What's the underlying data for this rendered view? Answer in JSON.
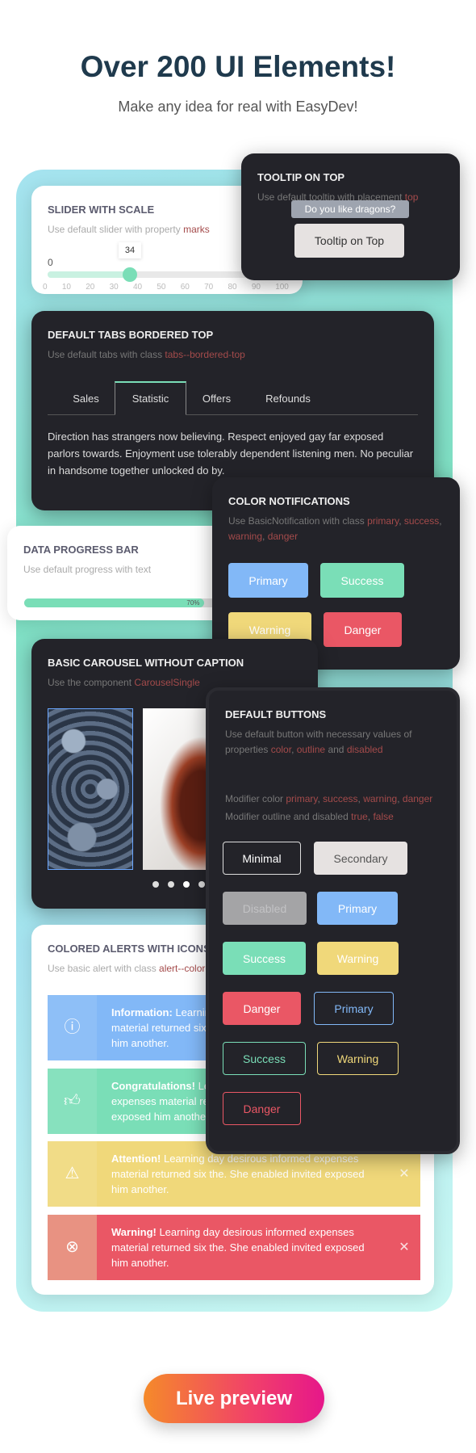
{
  "header": {
    "title": "Over 200 UI Elements!",
    "subtitle": "Make any idea for real with EasyDev!"
  },
  "slider": {
    "title": "Slider with scale",
    "desc": "Use default slider with property ",
    "desc_hl": "marks",
    "value": 34,
    "min_label": "0",
    "value_label": "34",
    "marks": [
      "0",
      "10",
      "20",
      "30",
      "40",
      "50",
      "60",
      "70",
      "80",
      "90",
      "100"
    ]
  },
  "tooltip": {
    "title": "Tooltip on top",
    "desc": "Use default tooltip with placement ",
    "desc_hl": "top",
    "tip": "Do you like dragons?",
    "button": "Tooltip on Top"
  },
  "tabs": {
    "title": "Default tabs bordered top",
    "desc": "Use default tabs with class ",
    "desc_hl": "tabs--bordered-top",
    "items": [
      "Sales",
      "Statistic",
      "Offers",
      "Refounds"
    ],
    "active": "Statistic",
    "content": "Direction has strangers now believing. Respect enjoyed gay far exposed parlors towards. Enjoyment use tolerably dependent listening men. No peculiar in handsome together unlocked do by."
  },
  "notifications": {
    "title": "Color notifications",
    "desc": "Use BasicNotification with class ",
    "hl1": "primary",
    "hl2": "success",
    "hl3": "warning",
    "hl4": "danger",
    "buttons": [
      "Primary",
      "Success",
      "Warning",
      "Danger"
    ]
  },
  "progress": {
    "title": "Data progress bar",
    "desc": "Use default progress with text",
    "value": 70,
    "label": "70%"
  },
  "carousel": {
    "title": "Basic carousel without caption",
    "desc": "Use the component ",
    "desc_hl": "CarouselSingle"
  },
  "buttons": {
    "title": "Default buttons",
    "desc1": "Use default button with necessary values of properties ",
    "hl_color": "color",
    "hl_outline": "outline",
    "and": " and ",
    "hl_disabled": "disabled",
    "mod1": "Modifier color ",
    "m_primary": "primary",
    "m_success": "success",
    "m_warning": "warning",
    "m_danger": "danger",
    "mod2": "Modifier outline and disabled ",
    "m_true": "true",
    "m_false": "false",
    "items": [
      "Minimal",
      "Secondary",
      "Disabled",
      "Primary",
      "Success",
      "Warning",
      "Danger",
      "Primary",
      "Success",
      "Warning",
      "Danger"
    ]
  },
  "alerts": {
    "title": "Colored alerts with icons",
    "desc": "Use basic alert with class ",
    "desc_hl": "alert--colored",
    "items": [
      {
        "bold": "Information:",
        "text": " Learning day desirous informed expenses material returned six the. She enabled invited exposed him another.",
        "icon": "info-icon"
      },
      {
        "bold": "Congratulations!",
        "text": " Learning day desirous informed expenses material returned six the. She enabled invited exposed him another.",
        "icon": "thumbs-up-icon"
      },
      {
        "bold": "Attention!",
        "text": " Learning day desirous informed expenses material returned six the. She enabled invited exposed him another.",
        "icon": "comment-alert-icon"
      },
      {
        "bold": "Warning!",
        "text": " Learning day desirous informed expenses material returned six the. She enabled invited exposed him another.",
        "icon": "close-circle-icon"
      }
    ]
  },
  "cta": {
    "label": "Live preview"
  },
  "colors": {
    "primary": "#82b8f7",
    "success": "#7adeb7",
    "warning": "#f0d87a",
    "danger": "#ea5765"
  }
}
